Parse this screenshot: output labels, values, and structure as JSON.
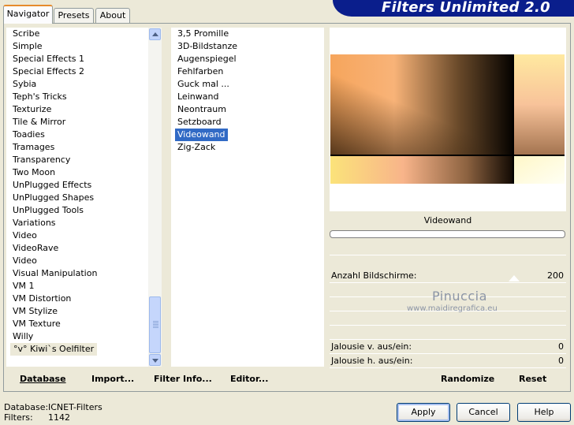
{
  "title": "Filters Unlimited 2.0",
  "tabs": [
    {
      "label": "Navigator",
      "active": true
    },
    {
      "label": "Presets",
      "active": false
    },
    {
      "label": "About",
      "active": false
    }
  ],
  "categories": [
    "Scribe",
    "Simple",
    "Special Effects 1",
    "Special Effects 2",
    "Sybia",
    "Teph's Tricks",
    "Texturize",
    "Tile & Mirror",
    "Toadies",
    "Tramages",
    "Transparency",
    "Two Moon",
    "UnPlugged Effects",
    "UnPlugged Shapes",
    "UnPlugged Tools",
    "Variations",
    "Video",
    "VideoRave",
    "Video",
    "Visual Manipulation",
    "VM 1",
    "VM Distortion",
    "VM Stylize",
    "VM Texture",
    "Willy",
    "°v° Kiwi`s Oelfilter"
  ],
  "selected_category": "°v° Kiwi`s Oelfilter",
  "filters": [
    "3,5 Promille",
    "3D-Bildstanze",
    "Augenspiegel",
    "Fehlfarben",
    "Guck mal ...",
    "Leinwand",
    "Neontraum",
    "Setzboard",
    "Videowand",
    "Zig-Zack"
  ],
  "selected_filter": "Videowand",
  "list_buttons": {
    "database": "Database",
    "import": "Import...",
    "filter_info": "Filter Info...",
    "editor": "Editor..."
  },
  "filter_name": "Videowand",
  "parameters": [
    {
      "label": "Anzahl Bildschirme:",
      "value": "200"
    },
    {
      "label": "Jalousie v. aus/ein:",
      "value": "0"
    },
    {
      "label": "Jalousie h. aus/ein:",
      "value": "0"
    }
  ],
  "watermark": {
    "line1": "Pinuccia",
    "line2": "www.maidiregrafica.eu"
  },
  "right_buttons": {
    "randomize": "Randomize",
    "reset": "Reset"
  },
  "status": {
    "database_label": "Database:",
    "database_value": "ICNET-Filters",
    "filters_label": "Filters:",
    "filters_value": "1142"
  },
  "dialog_buttons": {
    "apply": "Apply",
    "cancel": "Cancel",
    "help": "Help"
  },
  "colors": {
    "dialog_bg": "#ECE9D8",
    "banner": "#0A1E8C",
    "selection": "#316AC5",
    "tab_accent": "#E68B2C"
  }
}
